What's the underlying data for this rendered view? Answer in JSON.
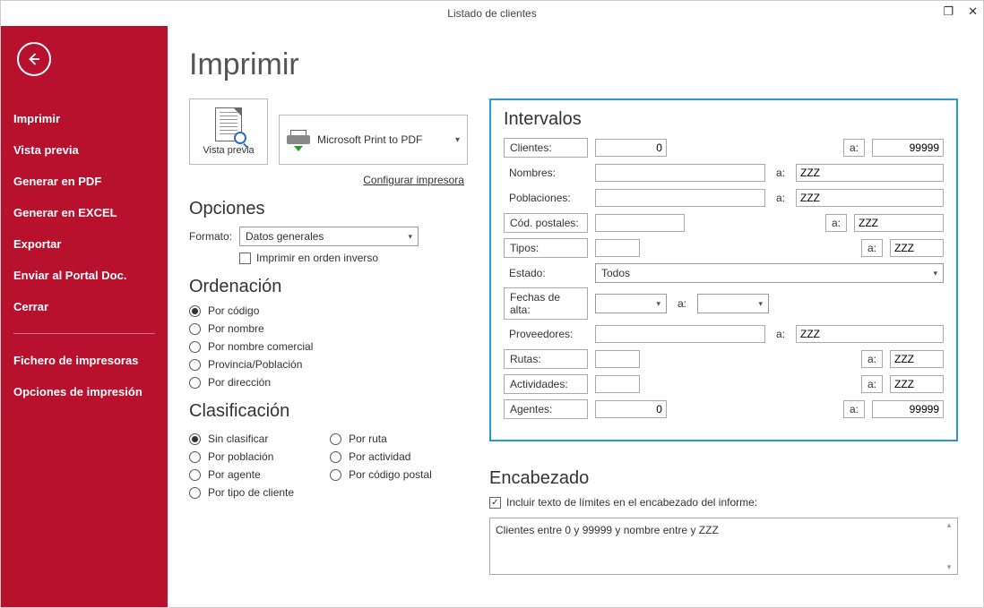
{
  "titlebar": {
    "title": "Listado de clientes"
  },
  "sidebar": {
    "items": [
      {
        "label": "Imprimir"
      },
      {
        "label": "Vista previa"
      },
      {
        "label": "Generar en PDF"
      },
      {
        "label": "Generar en EXCEL"
      },
      {
        "label": "Exportar"
      },
      {
        "label": "Enviar al Portal Doc."
      },
      {
        "label": "Cerrar"
      }
    ],
    "items2": [
      {
        "label": "Fichero de impresoras"
      },
      {
        "label": "Opciones de impresión"
      }
    ]
  },
  "page": {
    "title": "Imprimir",
    "preview_label": "Vista previa",
    "printer_name": "Microsoft Print to PDF",
    "config_link": "Configurar impresora"
  },
  "opciones": {
    "heading": "Opciones",
    "formato_label": "Formato:",
    "formato_value": "Datos generales",
    "reverse_label": "Imprimir en orden inverso"
  },
  "ordenacion": {
    "heading": "Ordenación",
    "options": [
      "Por código",
      "Por nombre",
      "Por nombre comercial",
      "Provincia/Población",
      "Por dirección"
    ],
    "selected": 0
  },
  "clasificacion": {
    "heading": "Clasificación",
    "left": [
      "Sin clasificar",
      "Por población",
      "Por agente",
      "Por tipo de cliente"
    ],
    "right": [
      "Por ruta",
      "Por actividad",
      "Por código postal"
    ],
    "selected": 0
  },
  "intervalos": {
    "heading": "Intervalos",
    "clientes": {
      "label": "Clientes:",
      "from": "0",
      "to": "99999"
    },
    "nombres": {
      "label": "Nombres:",
      "from": "",
      "to": "ZZZ"
    },
    "poblaciones": {
      "label": "Poblaciones:",
      "from": "",
      "to": "ZZZ"
    },
    "codpostales": {
      "label": "Cód. postales:",
      "from": "",
      "to": "ZZZ"
    },
    "tipos": {
      "label": "Tipos:",
      "from": "",
      "to": "ZZZ"
    },
    "estado": {
      "label": "Estado:",
      "value": "Todos"
    },
    "fechas": {
      "label": "Fechas de alta:",
      "from": "",
      "to": ""
    },
    "proveedores": {
      "label": "Proveedores:",
      "from": "",
      "to": "ZZZ"
    },
    "rutas": {
      "label": "Rutas:",
      "from": "",
      "to": "ZZZ"
    },
    "actividades": {
      "label": "Actividades:",
      "from": "",
      "to": "ZZZ"
    },
    "agentes": {
      "label": "Agentes:",
      "from": "0",
      "to": "99999"
    },
    "a": "a:"
  },
  "encabezado": {
    "heading": "Encabezado",
    "checkbox_label": "Incluir texto de límites en el encabezado del informe:",
    "text": "Clientes entre 0 y 99999 y nombre entre  y ZZZ"
  }
}
